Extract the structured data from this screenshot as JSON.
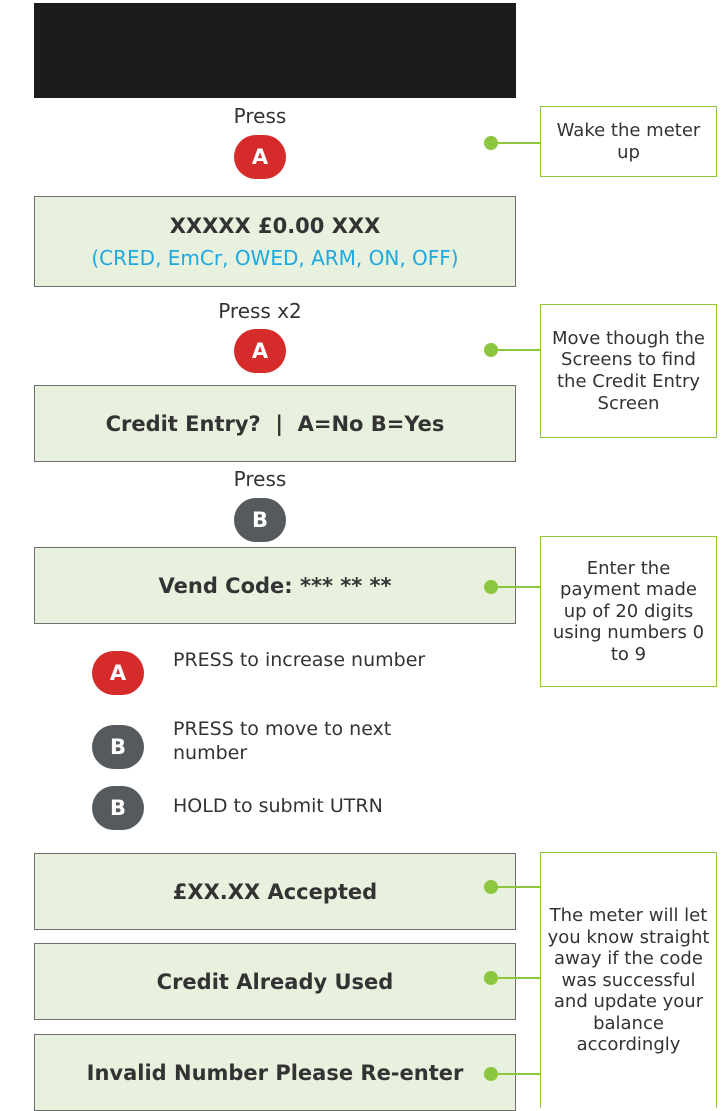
{
  "step1": {
    "press_label": "Press",
    "button": "A",
    "note": "Wake the meter up"
  },
  "screen1": {
    "main": "XXXXX £0.00 XXX",
    "sub": "(CRED, EmCr, OWED, ARM, ON, OFF)"
  },
  "step2": {
    "press_label": "Press x2",
    "button": "A",
    "note": "Move though the Screens to find the Credit Entry Screen"
  },
  "screen2": {
    "main": "Credit Entry?  |  A=No B=Yes"
  },
  "step3": {
    "press_label": "Press",
    "button": "B"
  },
  "screen3": {
    "main": "Vend Code: *** ** **",
    "note": "Enter the payment made up of 20 digits using numbers 0 to 9"
  },
  "instructions": [
    {
      "button": "A",
      "text": "PRESS to increase number"
    },
    {
      "button": "B",
      "text": "PRESS to move to next number"
    },
    {
      "button": "B",
      "text": "HOLD to submit UTRN"
    }
  ],
  "results": {
    "accepted": "£XX.XX Accepted",
    "used": "Credit Already Used",
    "invalid": "Invalid Number Please Re-enter",
    "note": "The meter will let you know straight away if the code was successful and update your balance accordingly"
  },
  "colors": {
    "button_a": "#d52b2b",
    "button_b": "#555a5e",
    "panel_bg": "#e8f0de",
    "accent_green": "#8dc63f",
    "sub_blue": "#1fa9e1"
  }
}
